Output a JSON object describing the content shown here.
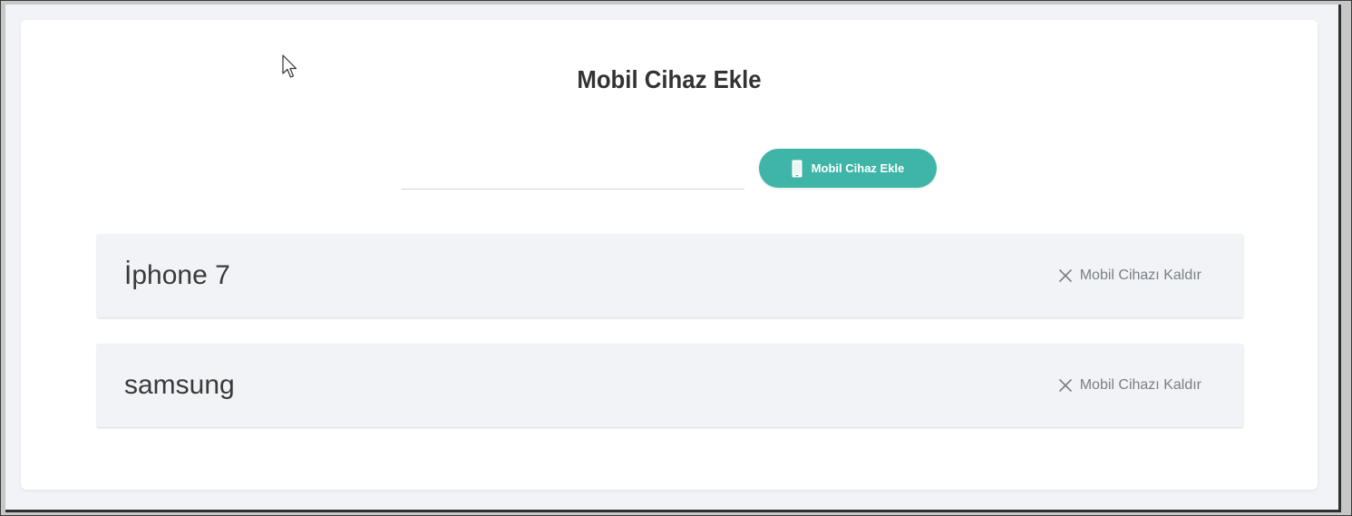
{
  "page": {
    "title": "Mobil Cihaz Ekle"
  },
  "add_form": {
    "input_value": "",
    "input_placeholder": "",
    "button_label": "Mobil Cihaz Ekle",
    "button_icon": "mobile-phone-icon",
    "accent_color": "#3fb5a8"
  },
  "devices": [
    {
      "name": "İphone 7",
      "remove_label": "Mobil Cihazı Kaldır",
      "remove_icon": "close-icon"
    },
    {
      "name": "samsung",
      "remove_label": "Mobil Cihazı Kaldır",
      "remove_icon": "close-icon"
    }
  ]
}
